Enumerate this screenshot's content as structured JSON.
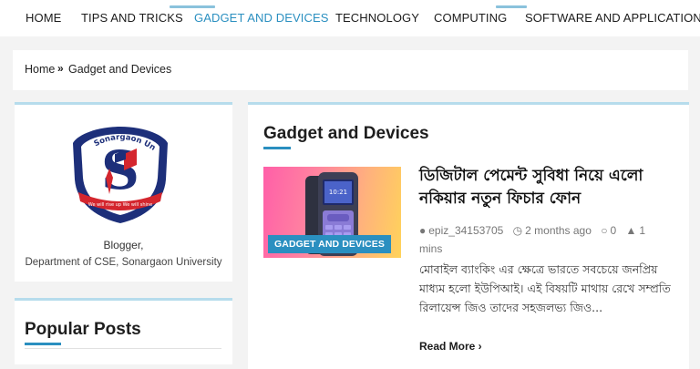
{
  "nav": {
    "items": [
      {
        "label": "HOME"
      },
      {
        "label": "TIPS AND TRICKS"
      },
      {
        "label": "GADGET AND DEVICES"
      },
      {
        "label": "TECHNOLOGY"
      },
      {
        "label": "COMPUTING"
      },
      {
        "label": "SOFTWARE AND APPLICATIONS"
      }
    ],
    "active_color": "#2a8fc0"
  },
  "breadcrumb": {
    "home": "Home",
    "separator": "»",
    "current": "Gadget and Devices"
  },
  "author_widget": {
    "logo_text": "Sonargaon Univers",
    "name": "Blogger,",
    "department": "Department of CSE, Sonargaon University"
  },
  "popular_posts": {
    "title": "Popular Posts"
  },
  "main": {
    "title": "Gadget and Devices",
    "post": {
      "badge": "GADGET AND DEVICES",
      "title": "ডিজিটাল পেমেন্ট সুবিধা নিয়ে এলো নকিয়ার নতুন ফিচার ফোন",
      "author": "epiz_34153705",
      "date": "2 months ago",
      "comments": "0",
      "views": "1",
      "views_unit": "mins",
      "excerpt": "মোবাইল ব্যাংকিং এর ক্ষেত্রে ভারতে সবচেয়ে জনপ্রিয় মাধ্যম হলো ইউপিআই। এই বিষয়টি মাথায় রেখে সম্প্রতি রিলায়েন্স জিও তাদের সহজলভ্য জিও...",
      "read_more": "Read More ›"
    }
  }
}
